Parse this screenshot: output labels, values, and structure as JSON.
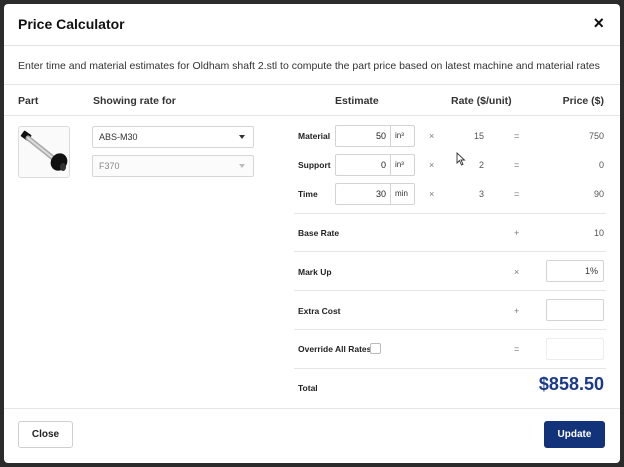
{
  "dialog": {
    "title": "Price Calculator",
    "close_glyph": "×",
    "intro": "Enter time and material estimates for Oldham shaft 2.stl to compute the part price based on latest machine and material rates"
  },
  "columns": {
    "part": "Part",
    "showing_rate_for": "Showing rate for",
    "estimate": "Estimate",
    "rate": "Rate ($/unit)",
    "price": "Price ($)"
  },
  "selects": {
    "material": "ABS-M30",
    "machine": "F370"
  },
  "rows": [
    {
      "label": "Material",
      "estimate": "50",
      "unit": "in³",
      "times": "×",
      "rate": "15",
      "equals": "=",
      "price": "750"
    },
    {
      "label": "Support",
      "estimate": "0",
      "unit": "in³",
      "times": "×",
      "rate": "2",
      "equals": "=",
      "price": "0"
    },
    {
      "label": "Time",
      "estimate": "30",
      "unit": "min",
      "times": "×",
      "rate": "3",
      "equals": "=",
      "price": "90"
    }
  ],
  "base_rate": {
    "label": "Base Rate",
    "op": "+",
    "value": "10"
  },
  "mark_up": {
    "label": "Mark Up",
    "op": "×",
    "value": "1%"
  },
  "extra_cost": {
    "label": "Extra Cost",
    "op": "+",
    "value": ""
  },
  "override": {
    "label": "Override All Rates",
    "op": "=",
    "value": ""
  },
  "total": {
    "label": "Total",
    "value": "$858.50"
  },
  "buttons": {
    "close": "Close",
    "update": "Update"
  },
  "colors": {
    "primary": "#12327a",
    "total_text": "#1a3a8a"
  }
}
